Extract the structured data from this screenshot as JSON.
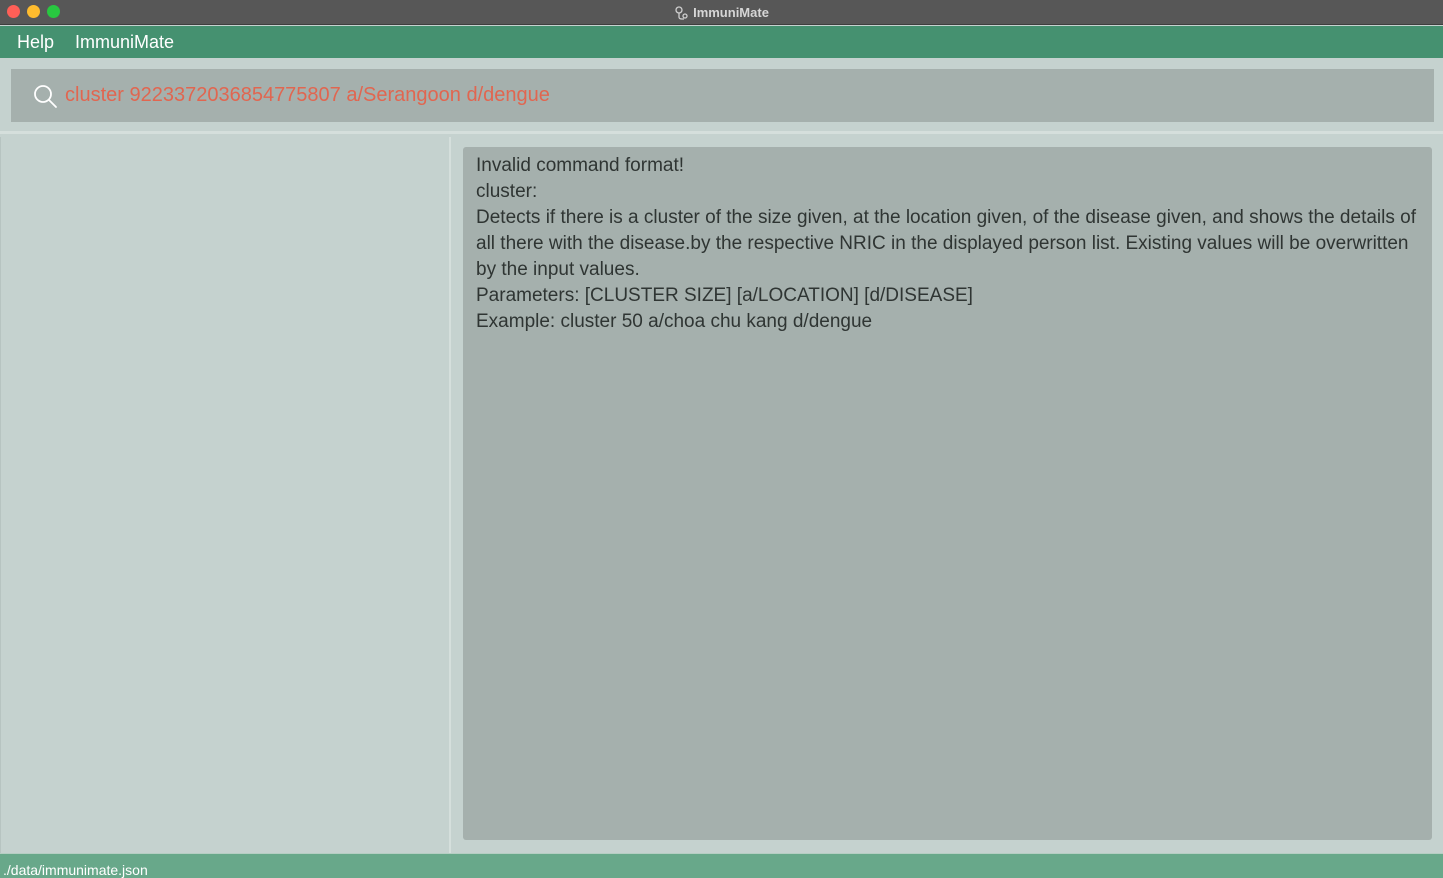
{
  "window": {
    "title": "ImmuniMate"
  },
  "menu": {
    "items": [
      "Help",
      "ImmuniMate"
    ]
  },
  "command": {
    "icon": "search-icon",
    "value": "cluster 9223372036854775807 a/Serangoon d/dengue",
    "text_color": "#e16650"
  },
  "result": {
    "lines": [
      "Invalid command format!",
      "cluster:",
      "Detects if there is a cluster of the size given, at the location given, of the disease given, and shows the details of all there with the disease.by the respective NRIC in the displayed person list. Existing values will be overwritten by the input values.",
      "Parameters: [CLUSTER SIZE] [a/LOCATION] [d/DISEASE]",
      "Example: cluster 50 a/choa chu kang d/dengue"
    ]
  },
  "status": {
    "file_path": "./data/immunimate.json"
  },
  "colors": {
    "accent": "#459170",
    "status_bar": "#68a88a",
    "panel": "#a5b0ad",
    "background": "#c5d2cf",
    "error_text": "#e16650"
  }
}
